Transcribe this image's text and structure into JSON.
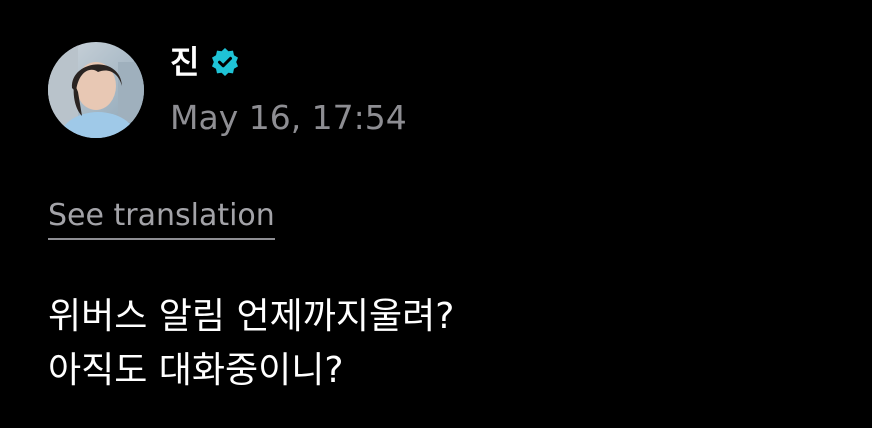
{
  "author": {
    "name": "진",
    "verified": true,
    "verified_color": "#1fc3d6",
    "avatar_icon": "profile-photo"
  },
  "post": {
    "timestamp": "May 16, 17:54",
    "translation_link": "See translation",
    "lines": [
      "위버스 알림 언제까지울려?",
      "아직도 대화중이니?"
    ]
  },
  "colors": {
    "background": "#000000",
    "text": "#ffffff",
    "muted": "#8e8e93"
  }
}
